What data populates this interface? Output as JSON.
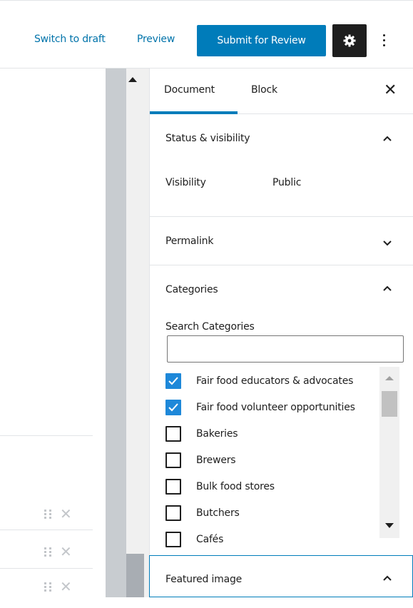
{
  "topbar": {
    "switch_to_draft": "Switch to draft",
    "preview": "Preview",
    "submit": "Submit for Review",
    "settings_icon": "gear-icon",
    "more_icon": "vertical-ellipsis-icon"
  },
  "sidebar": {
    "tabs": [
      {
        "label": "Document",
        "active": true
      },
      {
        "label": "Block",
        "active": false
      }
    ],
    "close_icon": "close-icon",
    "panels": {
      "status": {
        "title": "Status & visibility",
        "expanded": true,
        "visibility_label": "Visibility",
        "visibility_value": "Public"
      },
      "permalink": {
        "title": "Permalink",
        "expanded": false
      },
      "categories": {
        "title": "Categories",
        "expanded": true,
        "search_label": "Search Categories",
        "search_value": "",
        "items": [
          {
            "label": "Fair food educators & advocates",
            "checked": true
          },
          {
            "label": "Fair food volunteer opportunities",
            "checked": true
          },
          {
            "label": "Bakeries",
            "checked": false
          },
          {
            "label": "Brewers",
            "checked": false
          },
          {
            "label": "Bulk food stores",
            "checked": false
          },
          {
            "label": "Butchers",
            "checked": false
          },
          {
            "label": "Cafés",
            "checked": false
          }
        ]
      },
      "featured_image": {
        "title": "Featured image",
        "expanded": true
      }
    }
  },
  "colors": {
    "accent": "#007cba",
    "checkbox_checked": "#1e88d9",
    "text": "#1e1e1e"
  }
}
